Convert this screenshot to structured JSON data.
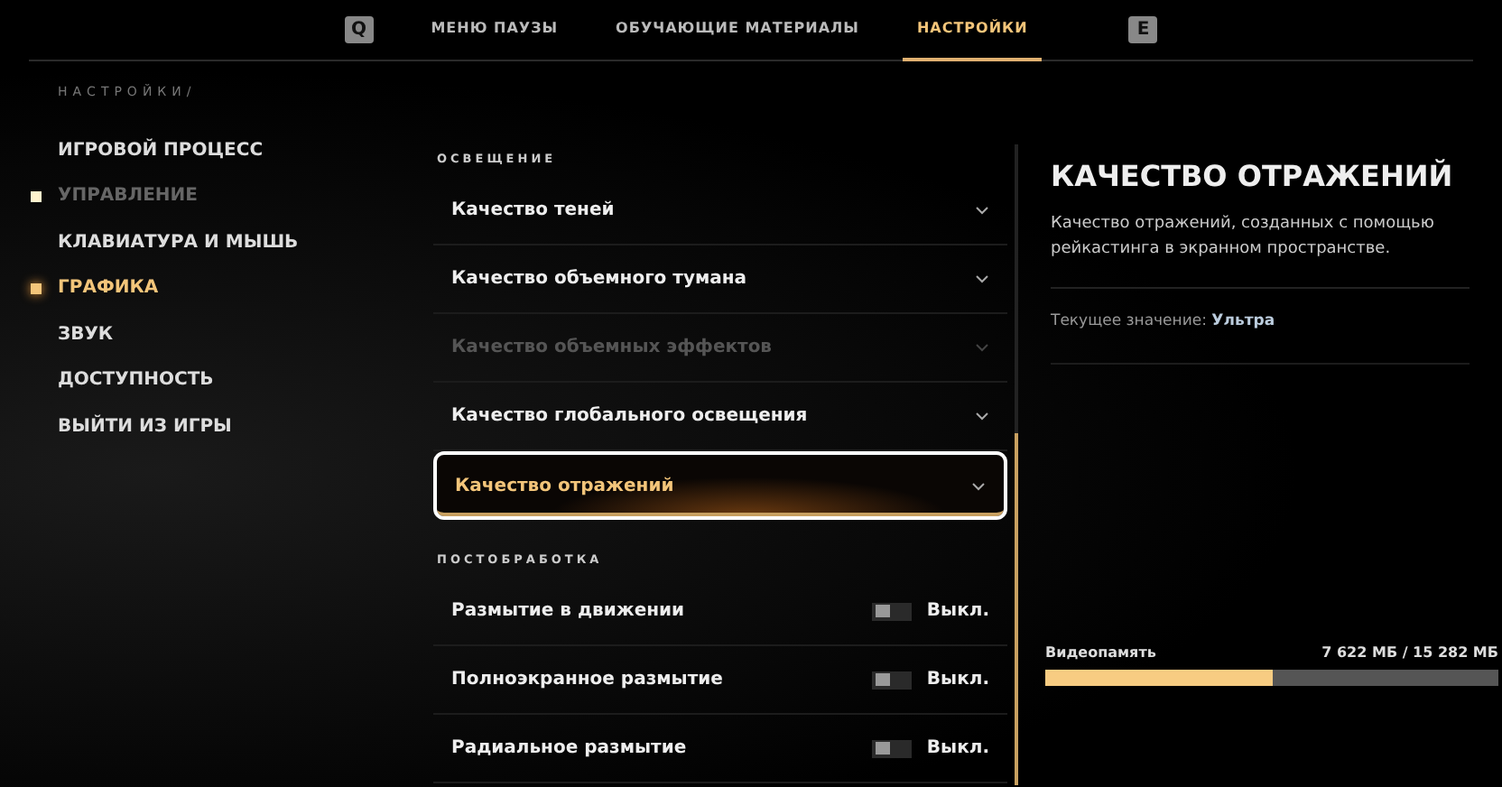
{
  "top_tabs": {
    "prev_key": "Q",
    "next_key": "E",
    "tabs": [
      {
        "label": "МЕНЮ ПАУЗЫ",
        "selected": false
      },
      {
        "label": "ОБУЧАЮЩИЕ МАТЕРИАЛЫ",
        "selected": false
      },
      {
        "label": "НАСТРОЙКИ",
        "selected": true
      }
    ]
  },
  "sidebar": {
    "breadcrumb": "НАСТРОЙКИ/",
    "items": [
      {
        "label": "ИГРОВОЙ ПРОЦЕСС",
        "selected": false,
        "locked": false
      },
      {
        "label": "УПРАВЛЕНИЕ",
        "selected": false,
        "locked": true
      },
      {
        "label": "КЛАВИАТУРА И МЫШЬ",
        "selected": false,
        "locked": false
      },
      {
        "label": "ГРАФИКА",
        "selected": true,
        "locked": false
      },
      {
        "label": "ЗВУК",
        "selected": false,
        "locked": false
      },
      {
        "label": "ДОСТУПНОСТЬ",
        "selected": false,
        "locked": false
      },
      {
        "label": "ВЫЙТИ ИЗ ИГРЫ",
        "selected": false,
        "locked": false
      }
    ]
  },
  "sections": [
    {
      "title": "ОСВЕЩЕНИЕ",
      "settings": [
        {
          "kind": "dropdown",
          "label": "Качество теней",
          "disabled": false,
          "selected": false
        },
        {
          "kind": "dropdown",
          "label": "Качество объемного тумана",
          "disabled": false,
          "selected": false
        },
        {
          "kind": "dropdown",
          "label": "Качество объемных эффектов",
          "disabled": true,
          "selected": false
        },
        {
          "kind": "dropdown",
          "label": "Качество глобального освещения",
          "disabled": false,
          "selected": false
        },
        {
          "kind": "dropdown",
          "label": "Качество отражений",
          "disabled": false,
          "selected": true
        }
      ]
    },
    {
      "title": "ПОСТОБРАБОТКА",
      "settings": [
        {
          "kind": "toggle",
          "label": "Размытие в движении",
          "on": false,
          "value": "Выкл.",
          "disabled": false,
          "selected": false
        },
        {
          "kind": "toggle",
          "label": "Полноэкранное размытие",
          "on": false,
          "value": "Выкл.",
          "disabled": false,
          "selected": false
        },
        {
          "kind": "toggle",
          "label": "Радиальное размытие",
          "on": false,
          "value": "Выкл.",
          "disabled": false,
          "selected": false
        }
      ]
    }
  ],
  "details": {
    "title": "КАЧЕСТВО ОТРАЖЕНИЙ",
    "description": "Качество отражений, созданных с помощью рейкастинга в экранном пространстве.",
    "current_label": "Текущее значение:",
    "current_value": "Ультра"
  },
  "video_memory": {
    "label": "Видеопамять",
    "reading": "7 622 МБ / 15 282 МБ",
    "level": 0.5
  }
}
